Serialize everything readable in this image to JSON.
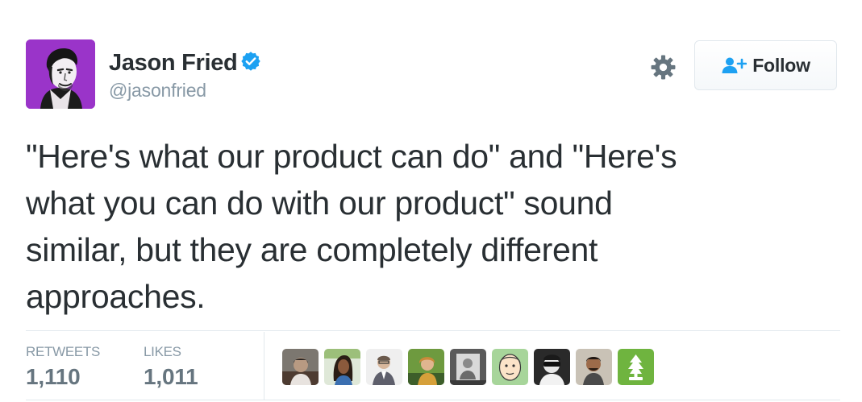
{
  "user": {
    "display_name": "Jason Fried",
    "handle": "@jasonfried",
    "verified": true,
    "avatar_icon": "user-avatar"
  },
  "actions": {
    "settings_icon": "gear-icon",
    "follow_label": "Follow",
    "follow_icon": "person-plus-icon"
  },
  "tweet": {
    "text": "\"Here's what our product can do\" and \"Here's\nwhat you can do with our product\" sound\nsimilar, but they are completely different\napproaches."
  },
  "stats": {
    "retweets_label": "RETWEETS",
    "retweets_value": "1,110",
    "likes_label": "LIKES",
    "likes_value": "1,011"
  },
  "likers": [
    {
      "icon": "avatar-1"
    },
    {
      "icon": "avatar-2"
    },
    {
      "icon": "avatar-3"
    },
    {
      "icon": "avatar-4"
    },
    {
      "icon": "avatar-5"
    },
    {
      "icon": "avatar-6"
    },
    {
      "icon": "avatar-7"
    },
    {
      "icon": "avatar-8"
    },
    {
      "icon": "avatar-9"
    }
  ],
  "colors": {
    "verified_blue": "#1da1f2",
    "text": "#292f33",
    "muted": "#8899a6",
    "border": "#e1e8ed"
  }
}
